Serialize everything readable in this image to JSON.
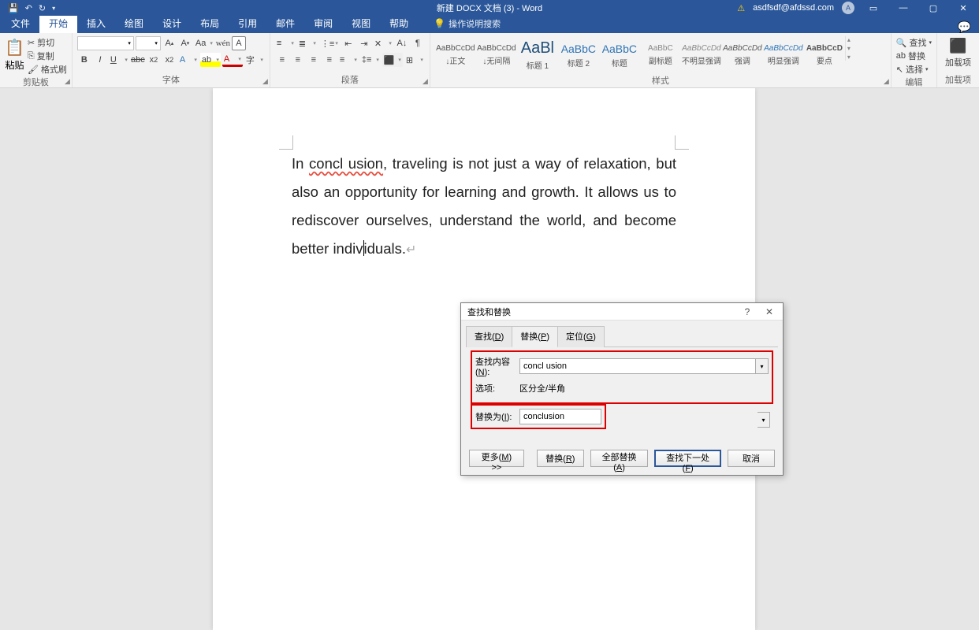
{
  "titlebar": {
    "title": "新建 DOCX 文档 (3) - Word",
    "user_email": "asdfsdf@afdssd.com",
    "avatar_initial": "A"
  },
  "menutabs": {
    "file": "文件",
    "home": "开始",
    "insert": "插入",
    "draw": "绘图",
    "design": "设计",
    "layout": "布局",
    "references": "引用",
    "mailings": "邮件",
    "review": "审阅",
    "view": "视图",
    "help": "帮助",
    "tellme": "操作说明搜索"
  },
  "ribbon": {
    "clipboard": {
      "label": "剪贴板",
      "paste": "粘贴",
      "cut": "剪切",
      "copy": "复制",
      "painter": "格式刷"
    },
    "font": {
      "label": "字体"
    },
    "paragraph": {
      "label": "段落"
    },
    "styles": {
      "label": "样式",
      "items": [
        {
          "preview": "AaBbCcDd",
          "name": "↓正文"
        },
        {
          "preview": "AaBbCcDd",
          "name": "↓无间隔"
        },
        {
          "preview": "AaBl",
          "name": "标题 1"
        },
        {
          "preview": "AaBbC",
          "name": "标题 2"
        },
        {
          "preview": "AaBbC",
          "name": "标题"
        },
        {
          "preview": "AaBbC",
          "name": "副标题"
        },
        {
          "preview": "AaBbCcDd",
          "name": "不明显强调"
        },
        {
          "preview": "AaBbCcDd",
          "name": "强调"
        },
        {
          "preview": "AaBbCcDd",
          "name": "明显强调"
        },
        {
          "preview": "AaBbCcD",
          "name": "要点"
        }
      ]
    },
    "editing": {
      "label": "编辑",
      "find": "查找",
      "replace": "替换",
      "select": "选择"
    },
    "addins": {
      "label": "加载项",
      "btn": "加载项"
    }
  },
  "document": {
    "text_pre": "In ",
    "text_err": "concl usion",
    "text_post1": ", traveling is not just a way of relaxation, but also an opportunity for learning and growth. It allows us to rediscover ourselves, understand the world, and become better indiv",
    "text_post2": "iduals."
  },
  "dialog": {
    "title": "查找和替换",
    "tabs": {
      "find": "查找(D)",
      "replace": "替换(P)",
      "goto": "定位(G)"
    },
    "find_label": "查找内容(N):",
    "find_value": "concl usion",
    "options_label": "选项:",
    "options_value": "区分全/半角",
    "replace_label": "替换为(I):",
    "replace_value": "conclusion",
    "buttons": {
      "more": "更多(M) >>",
      "replace": "替换(R)",
      "replace_all": "全部替换(A)",
      "find_next": "查找下一处(F)",
      "cancel": "取消"
    }
  }
}
